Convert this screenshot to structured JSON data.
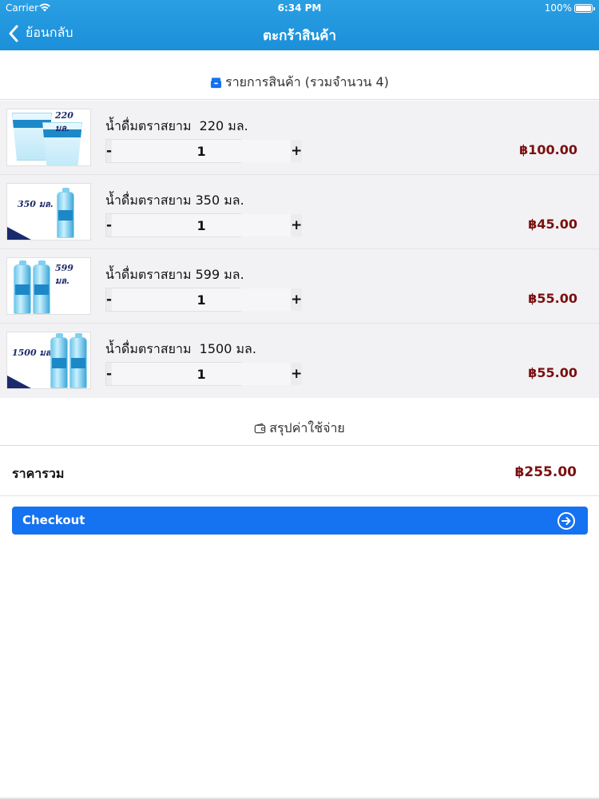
{
  "status_bar": {
    "carrier": "Carrier",
    "time": "6:34 PM",
    "battery_percent": "100%"
  },
  "nav": {
    "back_label": "ย้อนกลับ",
    "title": "ตะกร้าสินค้า"
  },
  "cart": {
    "heading": "รายการสินค้า (รวมจำนวน 4)",
    "items": [
      {
        "name": "น้ำดื่มตราสยาม  220 มล.",
        "thumb_label": "220 มล.",
        "quantity": "1",
        "price": "฿100.00"
      },
      {
        "name": "น้ำดื่มตราสยาม 350 มล.",
        "thumb_label": "350 มล.",
        "quantity": "1",
        "price": "฿45.00"
      },
      {
        "name": "น้ำดื่มตราสยาม 599 มล.",
        "thumb_label": "599 มล.",
        "quantity": "1",
        "price": "฿55.00"
      },
      {
        "name": "น้ำดื่มตราสยาม  1500 มล.",
        "thumb_label": "1500 มล.",
        "quantity": "1",
        "price": "฿55.00"
      }
    ],
    "minus_label": "-",
    "plus_label": "+"
  },
  "summary": {
    "heading": "สรุปค่าใช้จ่าย",
    "total_label": "ราคารวม",
    "total_value": "฿255.00"
  },
  "checkout": {
    "label": "Checkout"
  },
  "colors": {
    "header": "#1b8fd9",
    "checkout_button": "#1572f0",
    "price": "#7a1010",
    "list_background": "#f2f2f4"
  }
}
